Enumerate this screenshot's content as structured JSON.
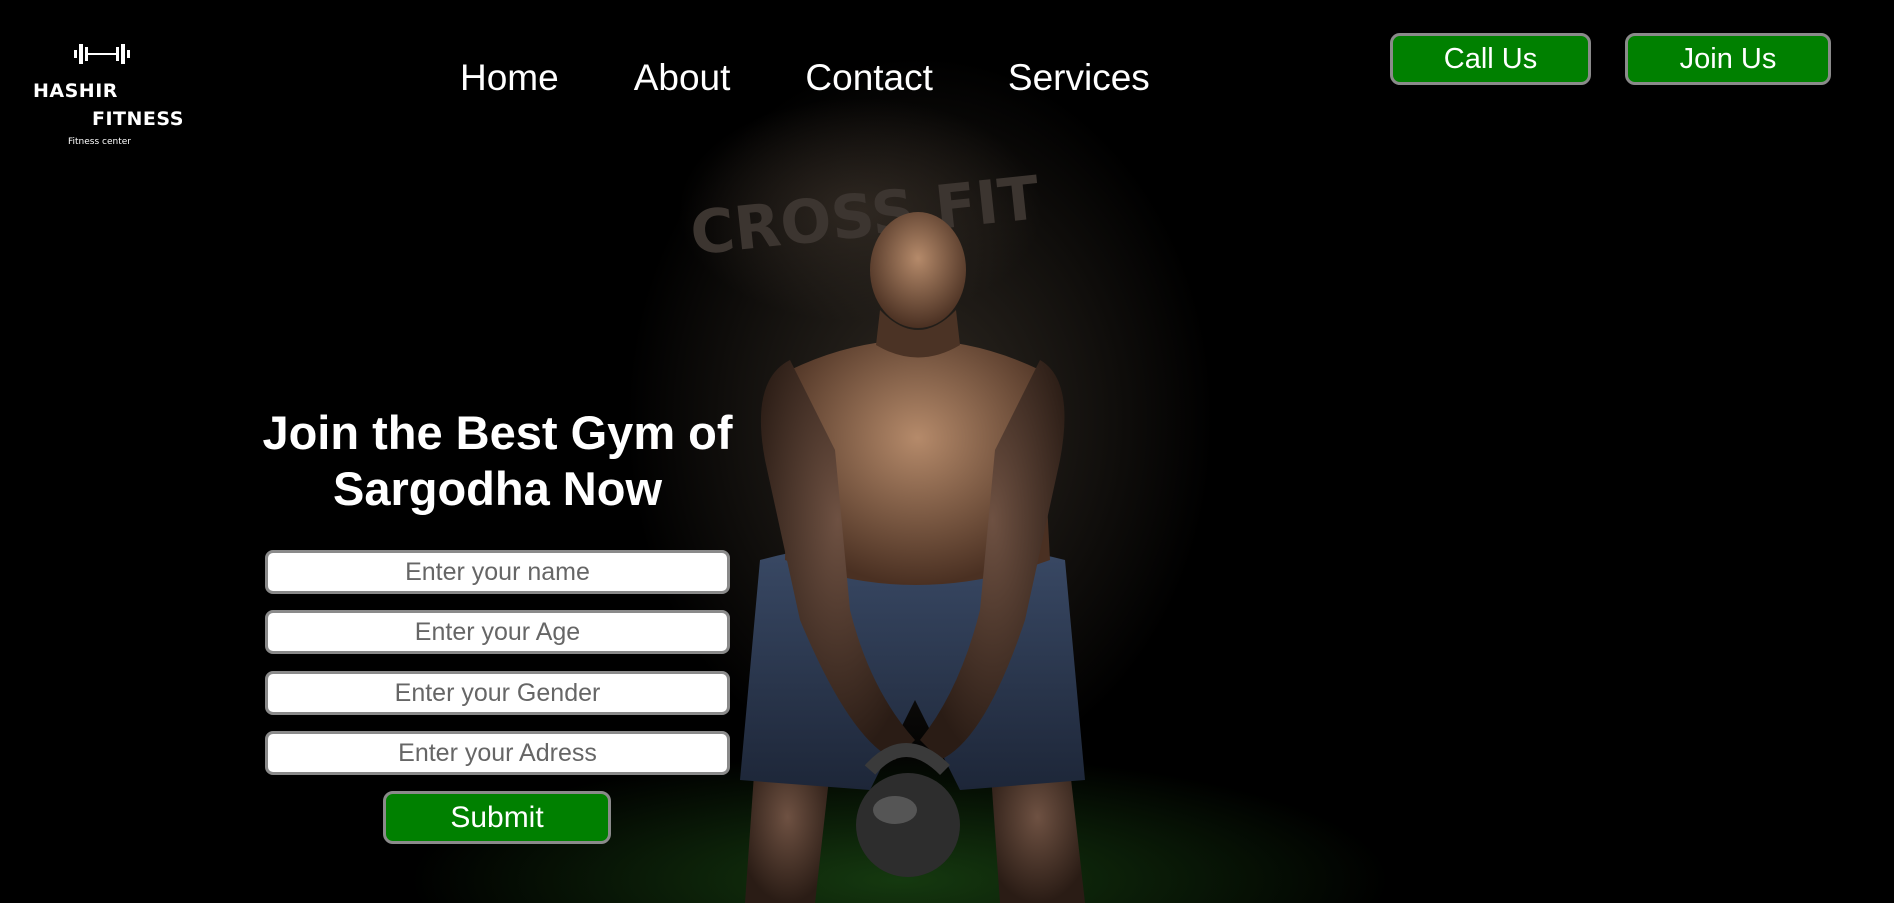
{
  "logo": {
    "line1": "HASHIR",
    "line2": "FITNESS",
    "tagline": "Fitness center",
    "icon": "barbell-icon"
  },
  "nav": {
    "items": [
      "Home",
      "About",
      "Contact",
      "Services"
    ]
  },
  "header_buttons": {
    "call_label": "Call Us",
    "join_label": "Join Us"
  },
  "hero": {
    "headline_line1": "Join the Best Gym of",
    "headline_line2": "Sargodha Now",
    "background_wall_text": "CROSS FIT"
  },
  "form": {
    "name_placeholder": "Enter your name",
    "age_placeholder": "Enter your Age",
    "gender_placeholder": "Enter your Gender",
    "address_placeholder": "Enter your Adress",
    "submit_label": "Submit"
  },
  "colors": {
    "accent_green": "#008000",
    "background": "#000000",
    "text": "#ffffff",
    "button_border": "#8a8a8a"
  }
}
